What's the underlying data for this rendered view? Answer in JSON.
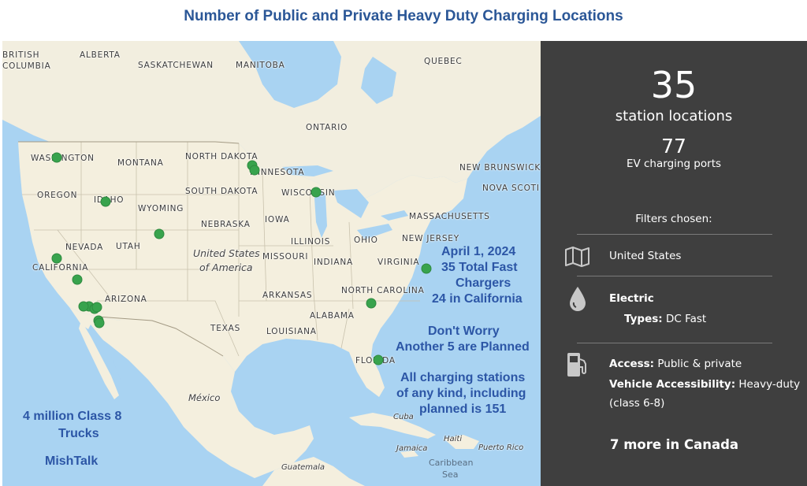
{
  "title": "Number of Public and Private Heavy Duty Charging Locations",
  "map": {
    "labels": {
      "british_columbia_1": "BRITISH",
      "british_columbia_2": "COLUMBIA",
      "alberta": "ALBERTA",
      "saskatchewan": "SASKATCHEWAN",
      "manitoba": "MANITOBA",
      "quebec": "QUEBEC",
      "ontario": "ONTARIO",
      "washington": "WASHINGTON",
      "montana": "MONTANA",
      "north_dakota": "NORTH DAKOTA",
      "minnesota": "MINNESOTA",
      "new_brunswick": "NEW BRUNSWICK",
      "oregon": "OREGON",
      "idaho": "IDAHO",
      "south_dakota": "SOUTH DAKOTA",
      "wisconsin": "WISCONSIN",
      "nova_scotia": "NOVA SCOTI",
      "wyoming": "WYOMING",
      "massachusetts": "MASSACHUSETTS",
      "iowa": "IOWA",
      "nebraska": "NEBRASKA",
      "new_jersey": "NEW JERSEY",
      "illinois": "ILLINOIS",
      "ohio": "OHIO",
      "nevada": "NEVADA",
      "utah": "UTAH",
      "usa_1": "United States",
      "usa_2": "of America",
      "missouri": "MISSOURI",
      "indiana": "INDIANA",
      "virginia": "VIRGINIA",
      "california": "CALIFORNIA",
      "arkansas": "ARKANSAS",
      "north_carolina": "NORTH CAROLINA",
      "arizona": "ARIZONA",
      "alabama": "ALABAMA",
      "texas": "TEXAS",
      "louisiana": "LOUISIANA",
      "florida": "FLORIDA",
      "mexico": "México",
      "cuba": "Cuba",
      "haiti": "Haiti",
      "jamaica": "Jamaica",
      "puerto_rico": "Puerto Rico",
      "caribbean_sea_1": "Caribbean",
      "caribbean_sea_2": "Sea",
      "guatemala": "Guatemala"
    },
    "annotations": {
      "date": "April 1, 2024",
      "total": "35 Total Fast",
      "chargers": "Chargers",
      "california_count": "24 in California",
      "dont_worry": "Don't Worry",
      "planned": "Another 5 are Planned",
      "all_1": "All charging stations",
      "all_2": "of any kind, including",
      "all_3": "planned is 151",
      "trucks_1": "4 million Class 8",
      "trucks_2": "Trucks",
      "source": "MishTalk"
    },
    "station_markers": [
      {
        "name": "Washington",
        "lon": -122.3,
        "lat": 47.6
      },
      {
        "name": "Idaho",
        "lon": -116.2,
        "lat": 43.6
      },
      {
        "name": "North Dakota 1",
        "lon": -98.0,
        "lat": 46.9
      },
      {
        "name": "North Dakota 2",
        "lon": -97.7,
        "lat": 46.5
      },
      {
        "name": "Utah/Colorado",
        "lon": -109.6,
        "lat": 40.7
      },
      {
        "name": "Wisconsin",
        "lon": -90.0,
        "lat": 44.5
      },
      {
        "name": "Northern California",
        "lon": -122.3,
        "lat": 38.5
      },
      {
        "name": "Central California",
        "lon": -119.8,
        "lat": 36.6
      },
      {
        "name": "Los Angeles area 1",
        "lon": -118.3,
        "lat": 34.2
      },
      {
        "name": "Los Angeles area 2",
        "lon": -117.6,
        "lat": 34.0
      },
      {
        "name": "Los Angeles area 3",
        "lon": -117.3,
        "lat": 34.1
      },
      {
        "name": "Los Angeles area 4",
        "lon": -119.0,
        "lat": 34.2
      },
      {
        "name": "San Diego area 1",
        "lon": -117.1,
        "lat": 32.9
      },
      {
        "name": "San Diego area 2",
        "lon": -117.0,
        "lat": 32.7
      },
      {
        "name": "Virginia",
        "lon": -76.3,
        "lat": 37.6
      },
      {
        "name": "Georgia",
        "lon": -83.2,
        "lat": 34.5
      },
      {
        "name": "Florida",
        "lon": -82.3,
        "lat": 29.4
      }
    ]
  },
  "panel": {
    "station_count": "35",
    "station_label": "station locations",
    "port_count": "77",
    "port_label": "EV charging ports",
    "filters_heading": "Filters chosen:",
    "country": "United States",
    "fuel_label": "Electric",
    "types_key": "Types:",
    "types_value": "DC Fast",
    "access_key": "Access:",
    "access_value": "Public & private",
    "vehicle_key": "Vehicle Accessibility:",
    "vehicle_value": "Heavy-duty",
    "vehicle_class": "(class 6-8)",
    "canada_note": "7 more in Canada",
    "icons": [
      "map-icon",
      "drop-icon",
      "fuel-pump-icon"
    ]
  },
  "colors": {
    "title": "#2b5797",
    "annotation": "#2c56a6",
    "marker": "#38a34d",
    "panel_bg": "#3f3f3f",
    "water": "#a9d3f2",
    "land": "#f4efde"
  }
}
